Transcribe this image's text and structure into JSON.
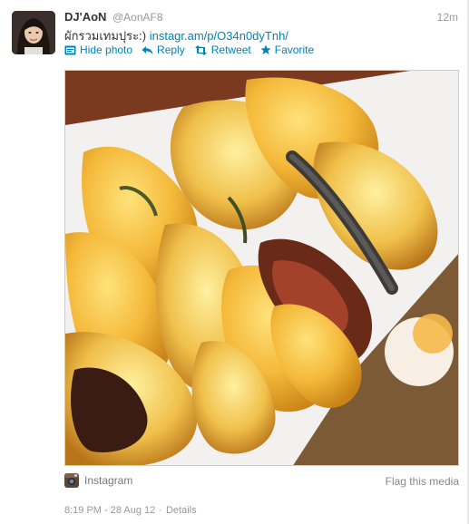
{
  "tweet": {
    "fullname": "DJ'AoN",
    "username": "@AonAF8",
    "timestamp": "12m",
    "text": "ผักรวมเทมปุระ:)",
    "link": "instagr.am/p/O34n0dyTnh/"
  },
  "actions": {
    "hide_photo": "Hide photo",
    "reply": "Reply",
    "retweet": "Retweet",
    "favorite": "Favorite"
  },
  "media": {
    "provider": "Instagram",
    "flag": "Flag this media"
  },
  "footer": {
    "datetime": "8:19 PM - 28 Aug 12",
    "separator": "·",
    "details": "Details"
  },
  "colors": {
    "link": "#0084b4",
    "text": "#333333",
    "muted": "#999999"
  }
}
